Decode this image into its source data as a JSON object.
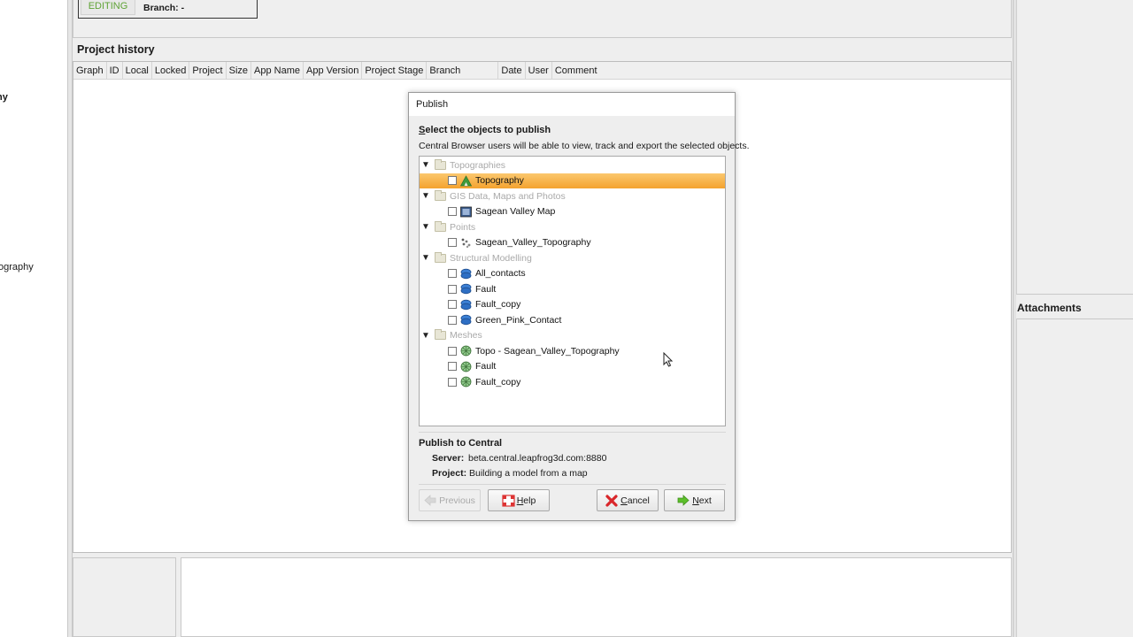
{
  "left_panel": {
    "items": [
      "hy",
      "ography"
    ]
  },
  "top_status": {
    "badge": "EDITING",
    "branch": "Branch: -"
  },
  "project_history": {
    "title": "Project history",
    "columns": [
      "Graph",
      "ID",
      "Local",
      "Locked",
      "Project",
      "Size",
      "App Name",
      "App Version",
      "Project Stage",
      "Branch",
      "Date",
      "User",
      "Comment"
    ]
  },
  "right_panel": {
    "attachments_title": "Attachments"
  },
  "dialog": {
    "title": "Publish",
    "heading_accel": "S",
    "heading_rest": "elect the objects to publish",
    "description": "Central Browser users will be able to view, track and export the selected objects.",
    "groups": [
      {
        "label": "Topographies",
        "items": [
          {
            "label": "Topography",
            "icon": "topography-icon",
            "selected": true,
            "checked": false
          }
        ]
      },
      {
        "label": "GIS Data, Maps and Photos",
        "items": [
          {
            "label": "Sagean Valley Map",
            "icon": "map-image-icon",
            "selected": false,
            "checked": false
          }
        ]
      },
      {
        "label": "Points",
        "items": [
          {
            "label": "Sagean_Valley_Topography",
            "icon": "points-icon",
            "selected": false,
            "checked": false
          }
        ]
      },
      {
        "label": "Structural Modelling",
        "items": [
          {
            "label": "All_contacts",
            "icon": "surface-icon",
            "checked": false
          },
          {
            "label": "Fault",
            "icon": "surface-icon",
            "checked": false
          },
          {
            "label": "Fault_copy",
            "icon": "surface-icon",
            "checked": false
          },
          {
            "label": "Green_Pink_Contact",
            "icon": "surface-icon",
            "checked": false
          }
        ]
      },
      {
        "label": "Meshes",
        "items": [
          {
            "label": "Topo - Sagean_Valley_Topography",
            "icon": "mesh-icon",
            "checked": false
          },
          {
            "label": "Fault",
            "icon": "mesh-icon",
            "checked": false
          },
          {
            "label": "Fault_copy",
            "icon": "mesh-icon",
            "checked": false
          }
        ]
      }
    ],
    "publish_section": {
      "title": "Publish to Central",
      "server_label": "Server:",
      "server_value": "beta.central.leapfrog3d.com:8880",
      "project_label": "Project:",
      "project_value": "Building a model from a map"
    },
    "buttons": {
      "previous": "Previous",
      "help_accel": "H",
      "help_rest": "elp",
      "cancel_accel": "C",
      "cancel_rest": "ancel",
      "next_accel": "N",
      "next_rest": "ext"
    }
  },
  "colors": {
    "editing_green": "#5fa336",
    "selection_orange": "#f4a32e",
    "surface_blue": "#2e6fc4"
  }
}
